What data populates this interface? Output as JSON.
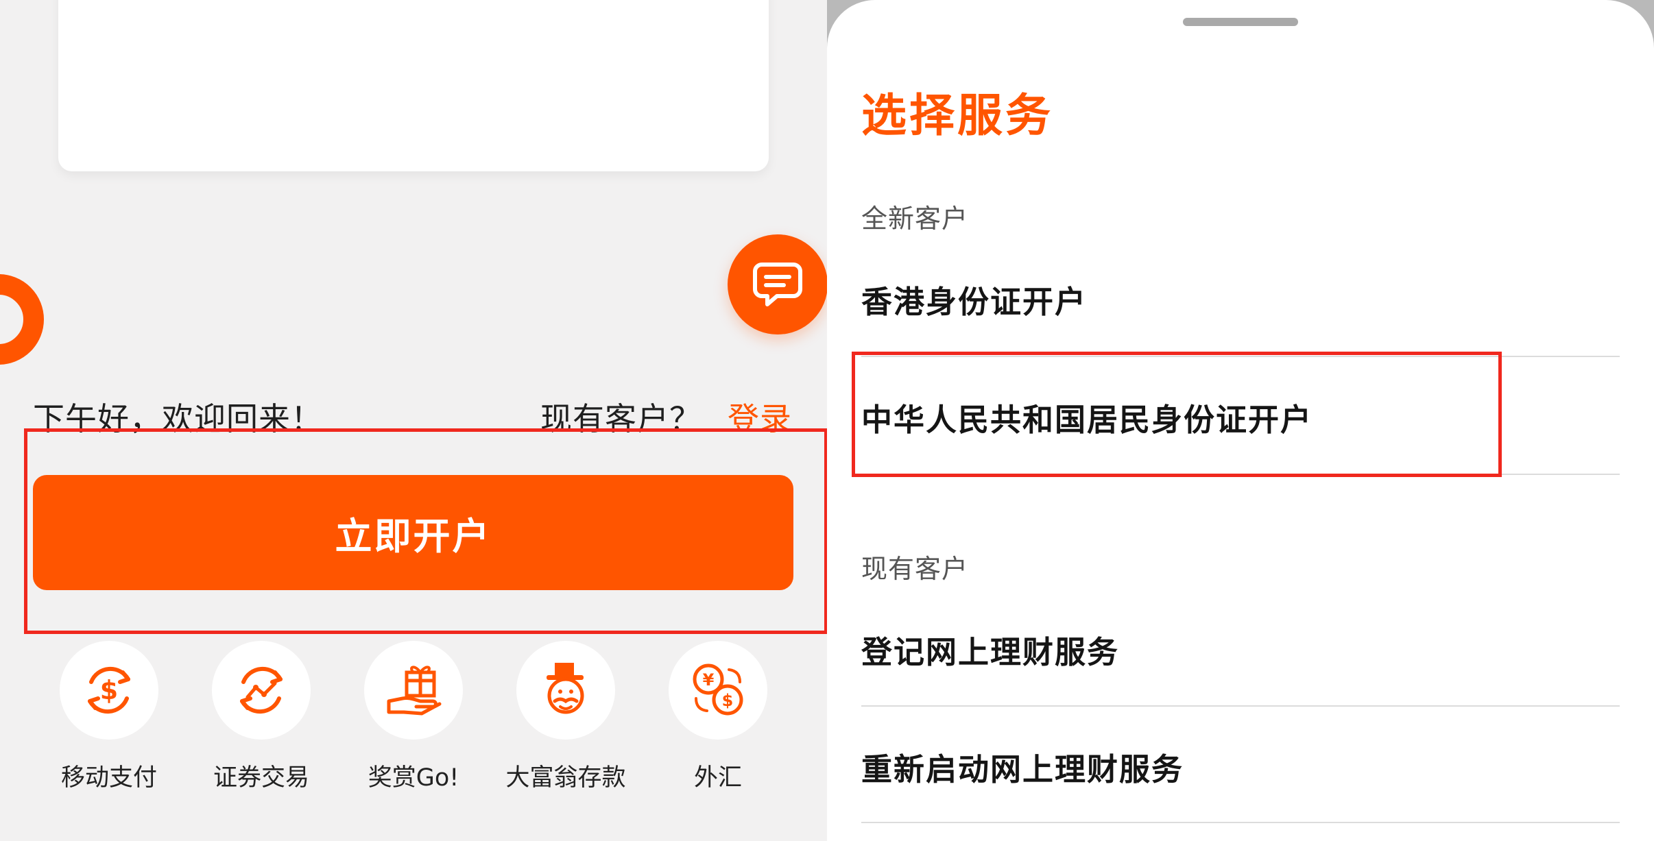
{
  "colors": {
    "accent": "#ff5500",
    "highlight": "#f0281e"
  },
  "left": {
    "greeting": "下午好，欢迎回来！",
    "existing_customer": "现有客户？",
    "login_link": "登录",
    "open_account_button": "立即开户",
    "chat_icon": "chat-bubble-icon",
    "shortcuts": [
      {
        "label": "移动支付",
        "icon": "mobile-payment-icon"
      },
      {
        "label": "证券交易",
        "icon": "securities-trading-icon"
      },
      {
        "label": "奖赏Go!",
        "icon": "rewards-gift-icon"
      },
      {
        "label": "大富翁存款",
        "icon": "monopoly-deposit-icon"
      },
      {
        "label": "外汇",
        "icon": "foreign-exchange-icon"
      }
    ]
  },
  "sheet": {
    "title": "选择服务",
    "sections": [
      {
        "title": "全新客户",
        "options": [
          "香港身份证开户",
          "中华人民共和国居民身份证开户"
        ]
      },
      {
        "title": "现有客户",
        "options": [
          "登记网上理财服务",
          "重新启动网上理财服务"
        ]
      }
    ]
  }
}
